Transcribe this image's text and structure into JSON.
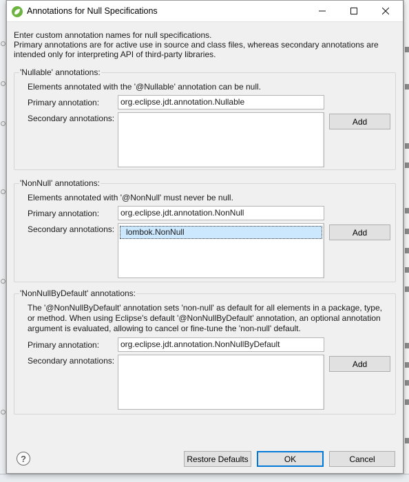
{
  "dialog": {
    "title": "Annotations for Null Specifications",
    "intro": [
      "Enter custom annotation names for null specifications.",
      "Primary annotations are for active use in source and class files, whereas secondary annotations are",
      "intended only for interpreting API of third-party libraries."
    ]
  },
  "groups": {
    "nullable": {
      "title": "'Nullable' annotations:",
      "description": [
        "Elements annotated with the '@Nullable' annotation can be null."
      ],
      "primary_label": "Primary annotation:",
      "primary_value": "org.eclipse.jdt.annotation.Nullable",
      "secondary_label": "Secondary annotations:",
      "add_label": "Add"
    },
    "nonnull": {
      "title": "'NonNull' annotations:",
      "description": [
        "Elements annotated with '@NonNull' must never be null."
      ],
      "primary_label": "Primary annotation:",
      "primary_value": "org.eclipse.jdt.annotation.NonNull",
      "secondary_label": "Secondary annotations:",
      "secondary_items": [
        "lombok.NonNull"
      ],
      "add_label": "Add"
    },
    "nonnullbydefault": {
      "title": "'NonNullByDefault' annotations:",
      "description": [
        "The '@NonNullByDefault' annotation sets 'non-null' as default for all elements in a package, type,",
        "or method. When using Eclipse's default '@NonNullByDefault' annotation, an optional annotation",
        "argument is evaluated, allowing to cancel or fine-tune the 'non-null' default."
      ],
      "primary_label": "Primary annotation:",
      "primary_value": "org.eclipse.jdt.annotation.NonNullByDefault",
      "secondary_label": "Secondary annotations:",
      "add_label": "Add"
    }
  },
  "footer": {
    "help_icon": "?",
    "restore_label": "Restore Defaults",
    "ok_label": "OK",
    "cancel_label": "Cancel"
  },
  "icons": {
    "app": "eclipse-spring-leaf-icon",
    "minimize": "minimize-icon",
    "maximize": "maximize-icon",
    "close": "close-icon",
    "help": "help-icon"
  },
  "colors": {
    "dialog_bg": "#f0f0f0",
    "selection": "#cce8ff",
    "default_button_border": "#0078d7",
    "app_icon": "#6cb33f"
  }
}
